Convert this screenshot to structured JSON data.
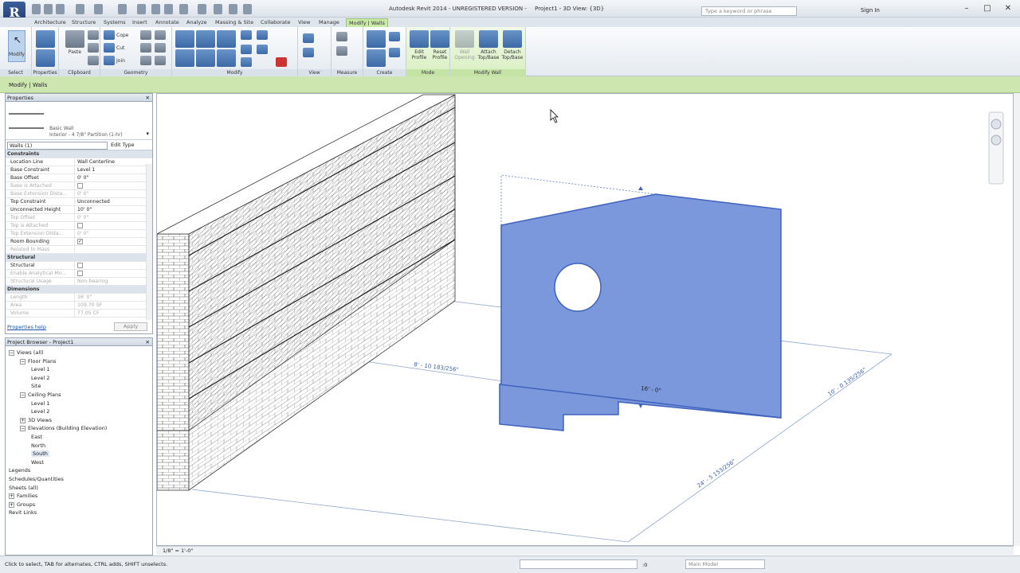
{
  "app": {
    "title": "Autodesk Revit 2014 - UNREGISTERED VERSION -",
    "project_view": "Project1 - 3D View: {3D}",
    "logo": "R",
    "search_placeholder": "Type a keyword or phrase",
    "signin": "Sign In"
  },
  "tabs": [
    "Architecture",
    "Structure",
    "Systems",
    "Insert",
    "Annotate",
    "Analyze",
    "Massing & Site",
    "Collaborate",
    "View",
    "Manage",
    "Modify | Walls"
  ],
  "ribbon": {
    "panels": [
      "Select",
      "Properties",
      "Clipboard",
      "Geometry",
      "Modify",
      "View",
      "Measure",
      "Create",
      "Mode",
      "Modify Wall"
    ],
    "buttons": {
      "modify": "Modify",
      "paste": "Paste",
      "cope": "Cope",
      "cut": "Cut",
      "join": "Join",
      "edit_profile": "Edit Profile",
      "reset_profile": "Reset Profile",
      "wall_opening": "Wall Opening",
      "attach_top_base": "Attach Top/Base",
      "detach_top_base": "Detach Top/Base"
    }
  },
  "options_bar": "Modify | Walls",
  "properties": {
    "header": "Properties",
    "family": "Basic Wall",
    "type": "Interior - 4 7/8\" Partition (1-hr)",
    "instance_selector": "Walls (1)",
    "edit_type": "Edit Type",
    "help": "Properties help",
    "apply": "Apply",
    "rows": [
      {
        "cat": "Constraints"
      },
      {
        "k": "Location Line",
        "v": "Wall Centerline"
      },
      {
        "k": "Base Constraint",
        "v": "Level 1"
      },
      {
        "k": "Base Offset",
        "v": "0' 0\""
      },
      {
        "k": "Base is Attached",
        "v": "",
        "dim": true,
        "chk": true
      },
      {
        "k": "Base Extension Dista...",
        "v": "0' 0\"",
        "dim": true
      },
      {
        "k": "Top Constraint",
        "v": "Unconnected"
      },
      {
        "k": "Unconnected Height",
        "v": "10' 0\""
      },
      {
        "k": "Top Offset",
        "v": "0' 0\"",
        "dim": true
      },
      {
        "k": "Top is Attached",
        "v": "",
        "dim": true,
        "chk": true
      },
      {
        "k": "Top Extension Dista...",
        "v": "0' 0\"",
        "dim": true
      },
      {
        "k": "Room Bounding",
        "v": "",
        "chk": true,
        "checked": true
      },
      {
        "k": "Related to Mass",
        "v": "",
        "dim": true
      },
      {
        "cat": "Structural"
      },
      {
        "k": "Structural",
        "v": "",
        "chk": true
      },
      {
        "k": "Enable Analytical Mo...",
        "v": "",
        "dim": true,
        "chk": true
      },
      {
        "k": "Structural Usage",
        "v": "Non-bearing",
        "dim": true
      },
      {
        "cat": "Dimensions"
      },
      {
        "k": "Length",
        "v": "16' 0\"",
        "dim": true
      },
      {
        "k": "Area",
        "v": "109.70 SF",
        "dim": true
      },
      {
        "k": "Volume",
        "v": "77.05 CF",
        "dim": true
      }
    ]
  },
  "browser": {
    "header": "Project Browser - Project1",
    "nodes": [
      {
        "t": "Views (all)",
        "lvl": 0,
        "exp": "−"
      },
      {
        "t": "Floor Plans",
        "lvl": 1,
        "exp": "−"
      },
      {
        "t": "Level 1",
        "lvl": 2
      },
      {
        "t": "Level 2",
        "lvl": 2
      },
      {
        "t": "Site",
        "lvl": 2
      },
      {
        "t": "Ceiling Plans",
        "lvl": 1,
        "exp": "−"
      },
      {
        "t": "Level 1",
        "lvl": 2
      },
      {
        "t": "Level 2",
        "lvl": 2
      },
      {
        "t": "3D Views",
        "lvl": 1,
        "exp": "+"
      },
      {
        "t": "Elevations (Building Elevation)",
        "lvl": 1,
        "exp": "−"
      },
      {
        "t": "East",
        "lvl": 2
      },
      {
        "t": "North",
        "lvl": 2
      },
      {
        "t": "South",
        "lvl": 2,
        "sel": true
      },
      {
        "t": "West",
        "lvl": 2
      },
      {
        "t": "Legends",
        "lvl": 0
      },
      {
        "t": "Schedules/Quantities",
        "lvl": 0
      },
      {
        "t": "Sheets (all)",
        "lvl": 0
      },
      {
        "t": "Families",
        "lvl": 0,
        "exp": "+"
      },
      {
        "t": "Groups",
        "lvl": 0,
        "exp": "+"
      },
      {
        "t": "Revit Links",
        "lvl": 0
      }
    ]
  },
  "view": {
    "dimensions": [
      "8' - 10 183/256\"",
      "16' - 0\"",
      "10' - 0 135/256\"",
      "24' - 5 153/256\""
    ],
    "scale": "1/8\" = 1'-0\""
  },
  "status": {
    "text": "Click to select, TAB for alternates, CTRL adds, SHIFT unselects.",
    "model": "Main Model",
    "zero": ":0"
  },
  "colors": {
    "selection": "#5b7fd6",
    "context_tab": "#c8eaa5"
  }
}
